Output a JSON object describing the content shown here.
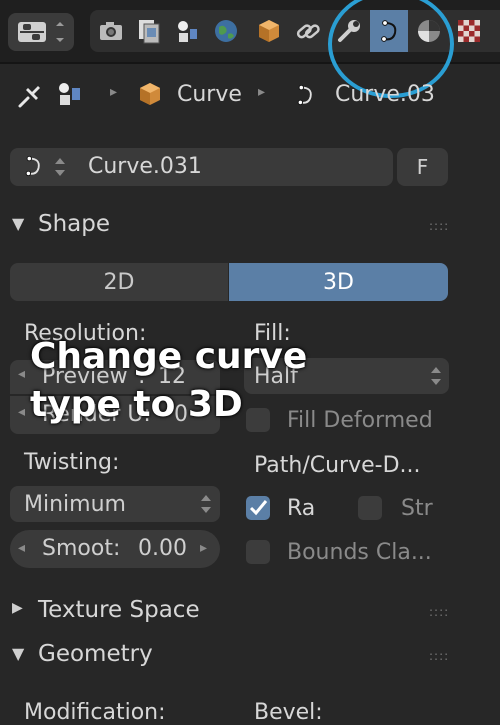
{
  "header": {
    "tabs": [
      {
        "icon": "render-icon"
      },
      {
        "icon": "render-layers-icon"
      },
      {
        "icon": "scene-icon"
      },
      {
        "icon": "world-icon"
      },
      {
        "icon": "object-icon"
      },
      {
        "icon": "constraints-icon"
      },
      {
        "icon": "modifiers-icon"
      },
      {
        "icon": "curve-data-icon",
        "active": true
      },
      {
        "icon": "material-icon"
      },
      {
        "icon": "texture-icon"
      }
    ]
  },
  "breadcrumb": {
    "object": "Curve",
    "data": "Curve.03"
  },
  "datablock": {
    "name": "Curve.031",
    "fake_user": "F"
  },
  "shape_panel": {
    "title": "Shape",
    "dim_2d": "2D",
    "dim_3d": "3D",
    "resolution_label": "Resolution:",
    "preview_label": "Preview",
    "preview_value": "12",
    "render_label": "Render U:",
    "render_value": "0",
    "fill_label": "Fill:",
    "fill_value": "Half",
    "fill_deformed": "Fill Deformed",
    "twisting_label": "Twisting:",
    "twisting_value": "Minimum",
    "smooth_label": "Smoot:",
    "smooth_value": "0.00",
    "path_label": "Path/Curve-D...",
    "radius_label": "Ra",
    "stretch_label": "Str",
    "bounds_clamp": "Bounds Cla..."
  },
  "panels": {
    "texture_space": "Texture Space",
    "geometry": "Geometry",
    "modification": "Modification:",
    "bevel": "Bevel:"
  },
  "overlay": {
    "line1": "Change curve",
    "line2": "type to 3D"
  },
  "colors": {
    "accent": "#5b7fa6",
    "annotation": "#2a9ed3"
  }
}
